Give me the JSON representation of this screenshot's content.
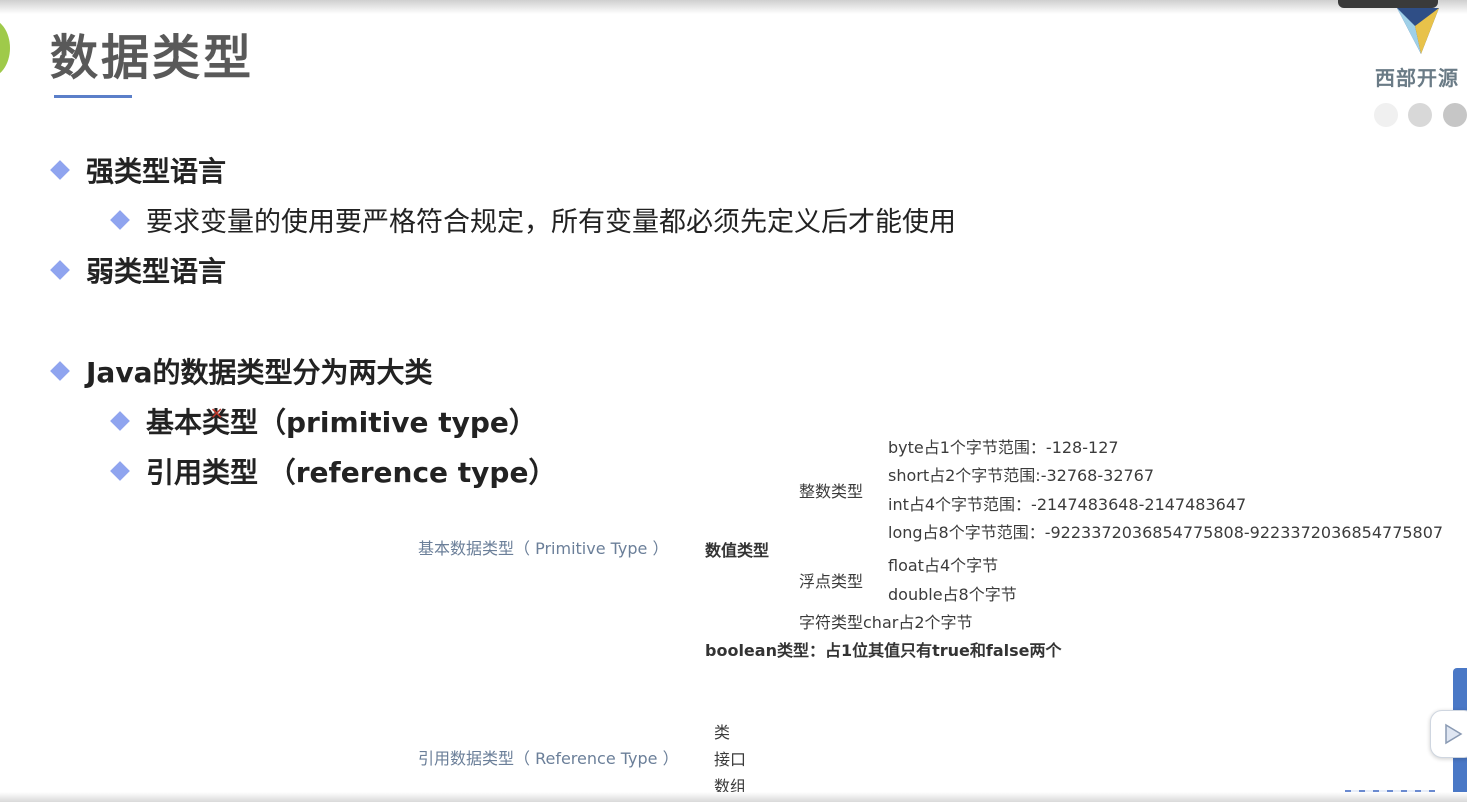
{
  "slide": {
    "title": "数据类型",
    "logo_text": "西部开源",
    "logo_icon": "triangle-logo-icon"
  },
  "bullets": {
    "strong_typed": "强类型语言",
    "strong_typed_desc": "要求变量的使用要严格符合规定，所有变量都必须先定义后才能使用",
    "weak_typed": "弱类型语言",
    "java_types": "Java的数据类型分为两大类",
    "primitive": "基本类型（primitive type）",
    "reference": "引用类型 （reference type）"
  },
  "diagram": {
    "primitive_root": "基本数据类型（ Primitive Type ）",
    "numeric": "数值类型",
    "integer": "整数类型",
    "byte": "byte占1个字节范围：-128-127",
    "short": "short占2个字节范围:-32768-32767",
    "int": "int占4个字节范围：-2147483648-2147483647",
    "long": "long占8个字节范围：-9223372036854775808-9223372036854775807",
    "floating": "浮点类型",
    "float": "float占4个字节",
    "double": "double占8个字节",
    "char": "字符类型char占2个字节",
    "boolean": "boolean类型：占1位其值只有true和false两个",
    "reference_root": "引用数据类型（ Reference Type ）",
    "class": "类",
    "interface": "接口",
    "array": "数组"
  },
  "colors": {
    "accent": "#5b7fc9",
    "bullet": "#8fa4ef",
    "title": "#595959",
    "side_button": "#4a78c6"
  }
}
